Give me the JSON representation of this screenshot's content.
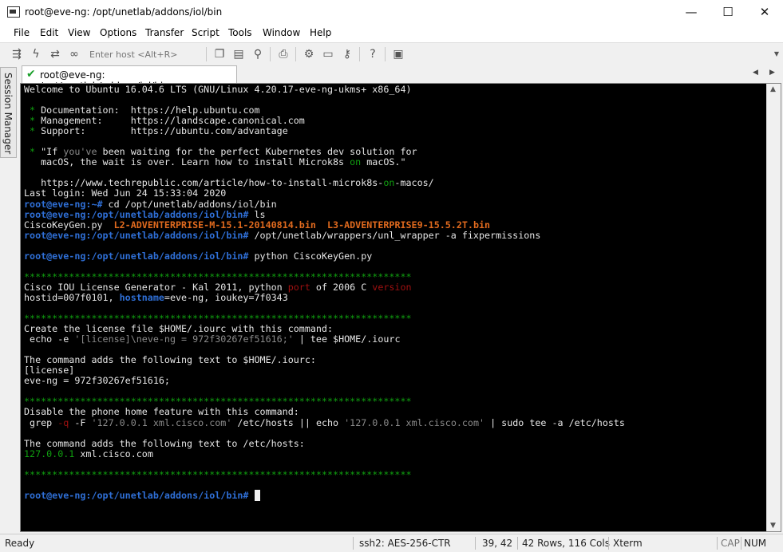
{
  "window": {
    "title": "root@eve-ng: /opt/unetlab/addons/iol/bin",
    "controls": {
      "minimize": "—",
      "maximize": "☐",
      "close": "✕"
    }
  },
  "menu": [
    "File",
    "Edit",
    "View",
    "Options",
    "Transfer",
    "Script",
    "Tools",
    "Window",
    "Help"
  ],
  "toolbar": {
    "host_placeholder": "Enter host <Alt+R>",
    "icons": [
      "connect-icon",
      "lightning-icon",
      "reconnect-icon",
      "link-icon",
      "copy-icon",
      "paste-icon",
      "find-icon",
      "print-icon",
      "settings-icon",
      "keymap-icon",
      "key-icon",
      "help-icon",
      "image-icon"
    ]
  },
  "side_panel": {
    "label": "Session Manager"
  },
  "tab": {
    "label": "root@eve-ng: /opt/unetlab/addons/iol/bin",
    "status": "connected"
  },
  "terminal": {
    "lines": [
      [
        [
          "Welcome to Ubuntu 16.04.6 LTS (GNU/Linux 4.20.17-eve-ng-ukms+ x86_64)",
          ""
        ]
      ],
      [],
      [
        [
          " * ",
          "c-green"
        ],
        [
          "Documentation:  https://help.ubuntu.com",
          ""
        ]
      ],
      [
        [
          " * ",
          "c-green"
        ],
        [
          "Management:     https://landscape.canonical.com",
          ""
        ]
      ],
      [
        [
          " * ",
          "c-green"
        ],
        [
          "Support:        https://ubuntu.com/advantage",
          ""
        ]
      ],
      [],
      [
        [
          " * ",
          "c-green"
        ],
        [
          "\"If ",
          ""
        ],
        [
          "you've",
          "c-gray"
        ],
        [
          " been waiting for the perfect Kubernetes dev solution for",
          ""
        ]
      ],
      [
        [
          "   macOS, the wait is over. Learn how to install Microk8s ",
          ""
        ],
        [
          "on",
          "c-green"
        ],
        [
          " macOS.\"",
          ""
        ]
      ],
      [],
      [
        [
          "   https://www.techrepublic.com/article/how-to-install-microk8s-",
          ""
        ],
        [
          "on",
          "c-green"
        ],
        [
          "-macos/",
          ""
        ]
      ],
      [
        [
          "Last login: Wed Jun 24 15:33:04 2020",
          ""
        ]
      ],
      [
        [
          "root@eve-ng:~#",
          "c-prompt"
        ],
        [
          " cd /opt/unetlab/addons/iol/bin",
          ""
        ]
      ],
      [
        [
          "root@eve-ng:/opt/unetlab/addons/iol/bin#",
          "c-prompt"
        ],
        [
          " ls",
          ""
        ]
      ],
      [
        [
          "CiscoKeyGen.py  ",
          ""
        ],
        [
          "L2-ADVENTERPRISE-M-15.1-20140814.bin",
          "c-orange"
        ],
        [
          "  ",
          ""
        ],
        [
          "L3-ADVENTERPRISE9-15.5.2T.bin",
          "c-orange"
        ]
      ],
      [
        [
          "root@eve-ng:/opt/unetlab/addons/iol/bin#",
          "c-prompt"
        ],
        [
          " /opt/unetlab/wrappers/unl_wrapper -a fixpermissions",
          ""
        ]
      ],
      [],
      [
        [
          "root@eve-ng:/opt/unetlab/addons/iol/bin#",
          "c-prompt"
        ],
        [
          " python CiscoKeyGen.py",
          ""
        ]
      ],
      [],
      [
        [
          "*********************************************************************",
          "c-green"
        ]
      ],
      [
        [
          "Cisco IOU License Generator - Kal 2011, python ",
          ""
        ],
        [
          "port",
          "c-red"
        ],
        [
          " of 2006 C ",
          ""
        ],
        [
          "version",
          "c-red"
        ]
      ],
      [
        [
          "hostid=007f0101, ",
          ""
        ],
        [
          "hostname",
          "c-blue"
        ],
        [
          "=eve-ng, ioukey=7f0343",
          ""
        ]
      ],
      [],
      [
        [
          "*********************************************************************",
          "c-green"
        ]
      ],
      [
        [
          "Create the license file $HOME/.iourc with this command:",
          ""
        ]
      ],
      [
        [
          " echo -e ",
          ""
        ],
        [
          "'[license]\\neve-ng = 972f30267ef51616;'",
          "c-gray"
        ],
        [
          " | tee $HOME/.iourc",
          ""
        ]
      ],
      [],
      [
        [
          "The command adds the following text to $HOME/.iourc:",
          ""
        ]
      ],
      [
        [
          "[license]",
          ""
        ]
      ],
      [
        [
          "eve-ng = 972f30267ef51616;",
          ""
        ]
      ],
      [],
      [
        [
          "*********************************************************************",
          "c-green"
        ]
      ],
      [
        [
          "Disable the phone home feature with this command:",
          ""
        ]
      ],
      [
        [
          " grep ",
          ""
        ],
        [
          "-q",
          "c-red"
        ],
        [
          " -F ",
          ""
        ],
        [
          "'127.0.0.1 xml.cisco.com'",
          "c-gray"
        ],
        [
          " /etc/hosts || echo ",
          ""
        ],
        [
          "'127.0.0.1 xml.cisco.com'",
          "c-gray"
        ],
        [
          " | sudo tee -a /etc/hosts",
          ""
        ]
      ],
      [],
      [
        [
          "The command adds the following text to /etc/hosts:",
          ""
        ]
      ],
      [
        [
          "127.0.0.1",
          "c-green"
        ],
        [
          " xml.cisco.com",
          ""
        ]
      ],
      [],
      [
        [
          "*********************************************************************",
          "c-green"
        ]
      ],
      [],
      [
        [
          "root@eve-ng:/opt/unetlab/addons/iol/bin#",
          "c-prompt"
        ],
        [
          " ",
          ""
        ],
        [
          " ",
          "c-cursor"
        ]
      ]
    ]
  },
  "status": {
    "ready": "Ready",
    "cipher": "ssh2: AES-256-CTR",
    "cursor_pos": "39,  42",
    "dimensions": "42 Rows, 116 Cols",
    "term_type": "Xterm",
    "caps": "CAP",
    "num": "NUM"
  }
}
